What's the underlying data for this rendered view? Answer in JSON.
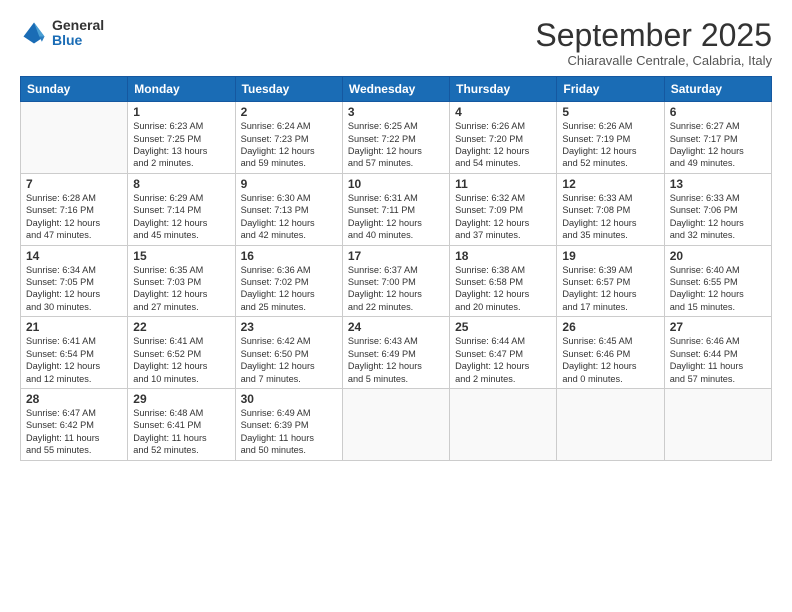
{
  "logo": {
    "general": "General",
    "blue": "Blue"
  },
  "header": {
    "month": "September 2025",
    "location": "Chiaravalle Centrale, Calabria, Italy"
  },
  "weekdays": [
    "Sunday",
    "Monday",
    "Tuesday",
    "Wednesday",
    "Thursday",
    "Friday",
    "Saturday"
  ],
  "weeks": [
    [
      {
        "day": "",
        "info": ""
      },
      {
        "day": "1",
        "info": "Sunrise: 6:23 AM\nSunset: 7:25 PM\nDaylight: 13 hours\nand 2 minutes."
      },
      {
        "day": "2",
        "info": "Sunrise: 6:24 AM\nSunset: 7:23 PM\nDaylight: 12 hours\nand 59 minutes."
      },
      {
        "day": "3",
        "info": "Sunrise: 6:25 AM\nSunset: 7:22 PM\nDaylight: 12 hours\nand 57 minutes."
      },
      {
        "day": "4",
        "info": "Sunrise: 6:26 AM\nSunset: 7:20 PM\nDaylight: 12 hours\nand 54 minutes."
      },
      {
        "day": "5",
        "info": "Sunrise: 6:26 AM\nSunset: 7:19 PM\nDaylight: 12 hours\nand 52 minutes."
      },
      {
        "day": "6",
        "info": "Sunrise: 6:27 AM\nSunset: 7:17 PM\nDaylight: 12 hours\nand 49 minutes."
      }
    ],
    [
      {
        "day": "7",
        "info": "Sunrise: 6:28 AM\nSunset: 7:16 PM\nDaylight: 12 hours\nand 47 minutes."
      },
      {
        "day": "8",
        "info": "Sunrise: 6:29 AM\nSunset: 7:14 PM\nDaylight: 12 hours\nand 45 minutes."
      },
      {
        "day": "9",
        "info": "Sunrise: 6:30 AM\nSunset: 7:13 PM\nDaylight: 12 hours\nand 42 minutes."
      },
      {
        "day": "10",
        "info": "Sunrise: 6:31 AM\nSunset: 7:11 PM\nDaylight: 12 hours\nand 40 minutes."
      },
      {
        "day": "11",
        "info": "Sunrise: 6:32 AM\nSunset: 7:09 PM\nDaylight: 12 hours\nand 37 minutes."
      },
      {
        "day": "12",
        "info": "Sunrise: 6:33 AM\nSunset: 7:08 PM\nDaylight: 12 hours\nand 35 minutes."
      },
      {
        "day": "13",
        "info": "Sunrise: 6:33 AM\nSunset: 7:06 PM\nDaylight: 12 hours\nand 32 minutes."
      }
    ],
    [
      {
        "day": "14",
        "info": "Sunrise: 6:34 AM\nSunset: 7:05 PM\nDaylight: 12 hours\nand 30 minutes."
      },
      {
        "day": "15",
        "info": "Sunrise: 6:35 AM\nSunset: 7:03 PM\nDaylight: 12 hours\nand 27 minutes."
      },
      {
        "day": "16",
        "info": "Sunrise: 6:36 AM\nSunset: 7:02 PM\nDaylight: 12 hours\nand 25 minutes."
      },
      {
        "day": "17",
        "info": "Sunrise: 6:37 AM\nSunset: 7:00 PM\nDaylight: 12 hours\nand 22 minutes."
      },
      {
        "day": "18",
        "info": "Sunrise: 6:38 AM\nSunset: 6:58 PM\nDaylight: 12 hours\nand 20 minutes."
      },
      {
        "day": "19",
        "info": "Sunrise: 6:39 AM\nSunset: 6:57 PM\nDaylight: 12 hours\nand 17 minutes."
      },
      {
        "day": "20",
        "info": "Sunrise: 6:40 AM\nSunset: 6:55 PM\nDaylight: 12 hours\nand 15 minutes."
      }
    ],
    [
      {
        "day": "21",
        "info": "Sunrise: 6:41 AM\nSunset: 6:54 PM\nDaylight: 12 hours\nand 12 minutes."
      },
      {
        "day": "22",
        "info": "Sunrise: 6:41 AM\nSunset: 6:52 PM\nDaylight: 12 hours\nand 10 minutes."
      },
      {
        "day": "23",
        "info": "Sunrise: 6:42 AM\nSunset: 6:50 PM\nDaylight: 12 hours\nand 7 minutes."
      },
      {
        "day": "24",
        "info": "Sunrise: 6:43 AM\nSunset: 6:49 PM\nDaylight: 12 hours\nand 5 minutes."
      },
      {
        "day": "25",
        "info": "Sunrise: 6:44 AM\nSunset: 6:47 PM\nDaylight: 12 hours\nand 2 minutes."
      },
      {
        "day": "26",
        "info": "Sunrise: 6:45 AM\nSunset: 6:46 PM\nDaylight: 12 hours\nand 0 minutes."
      },
      {
        "day": "27",
        "info": "Sunrise: 6:46 AM\nSunset: 6:44 PM\nDaylight: 11 hours\nand 57 minutes."
      }
    ],
    [
      {
        "day": "28",
        "info": "Sunrise: 6:47 AM\nSunset: 6:42 PM\nDaylight: 11 hours\nand 55 minutes."
      },
      {
        "day": "29",
        "info": "Sunrise: 6:48 AM\nSunset: 6:41 PM\nDaylight: 11 hours\nand 52 minutes."
      },
      {
        "day": "30",
        "info": "Sunrise: 6:49 AM\nSunset: 6:39 PM\nDaylight: 11 hours\nand 50 minutes."
      },
      {
        "day": "",
        "info": ""
      },
      {
        "day": "",
        "info": ""
      },
      {
        "day": "",
        "info": ""
      },
      {
        "day": "",
        "info": ""
      }
    ]
  ]
}
